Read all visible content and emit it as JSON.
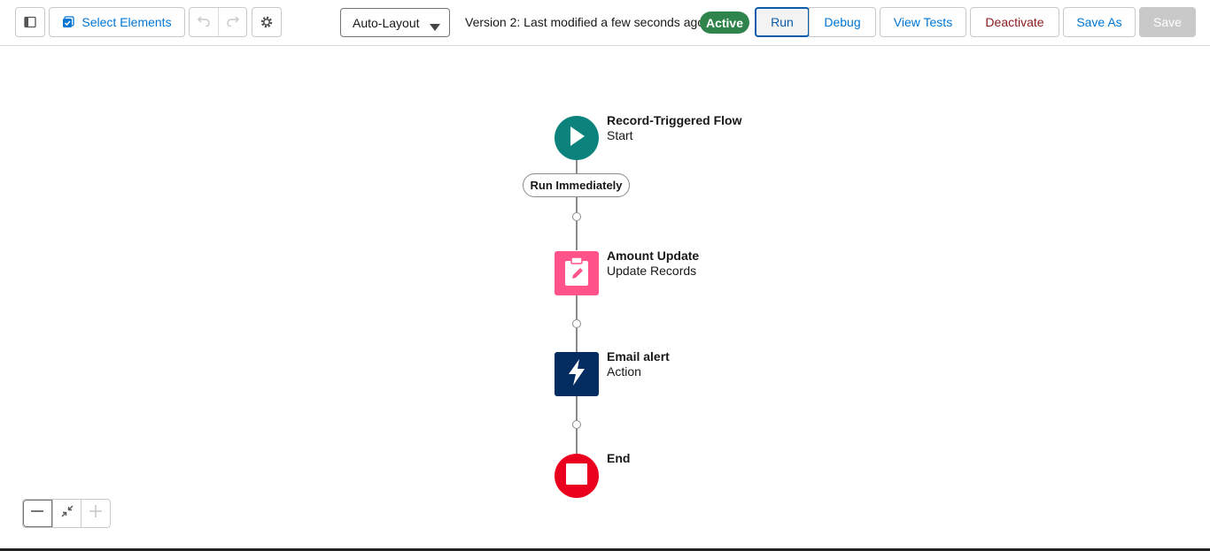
{
  "toolbar": {
    "toggle_panel_icon": "panel-left-icon",
    "select_elements_label": "Select Elements",
    "select_elements_icon": "select-elements-icon",
    "undo_icon": "undo-icon",
    "redo_icon": "redo-icon",
    "settings_icon": "gear-icon",
    "layout_select": {
      "selected": "Auto-Layout",
      "icon": "chevron-down-icon"
    },
    "version_text": "Version 2: Last modified a few seconds ago",
    "status_badge": "Active",
    "buttons": {
      "run": "Run",
      "debug": "Debug",
      "view_tests": "View Tests",
      "deactivate": "Deactivate",
      "save_as": "Save As",
      "save": "Save"
    }
  },
  "flow": {
    "start": {
      "title": "Record-Triggered Flow",
      "subtitle": "Start",
      "icon": "play-icon",
      "color": "#0b827c"
    },
    "path_label": "Run Immediately",
    "elements": [
      {
        "title": "Amount Update",
        "subtitle": "Update Records",
        "icon": "clipboard-edit-icon",
        "color": "#ff538a"
      },
      {
        "title": "Email alert",
        "subtitle": "Action",
        "icon": "lightning-icon",
        "color": "#032d60"
      }
    ],
    "end": {
      "title": "End",
      "icon": "stop-icon",
      "color": "#ea001e"
    }
  },
  "zoom_controls": {
    "zoom_out_icon": "minus-icon",
    "fit_icon": "fit-to-view-icon",
    "zoom_in_icon": "plus-icon"
  },
  "colors": {
    "brand_blue": "#0176d3",
    "active_green": "#2e844a",
    "deactivate_red": "#8c1c20"
  }
}
